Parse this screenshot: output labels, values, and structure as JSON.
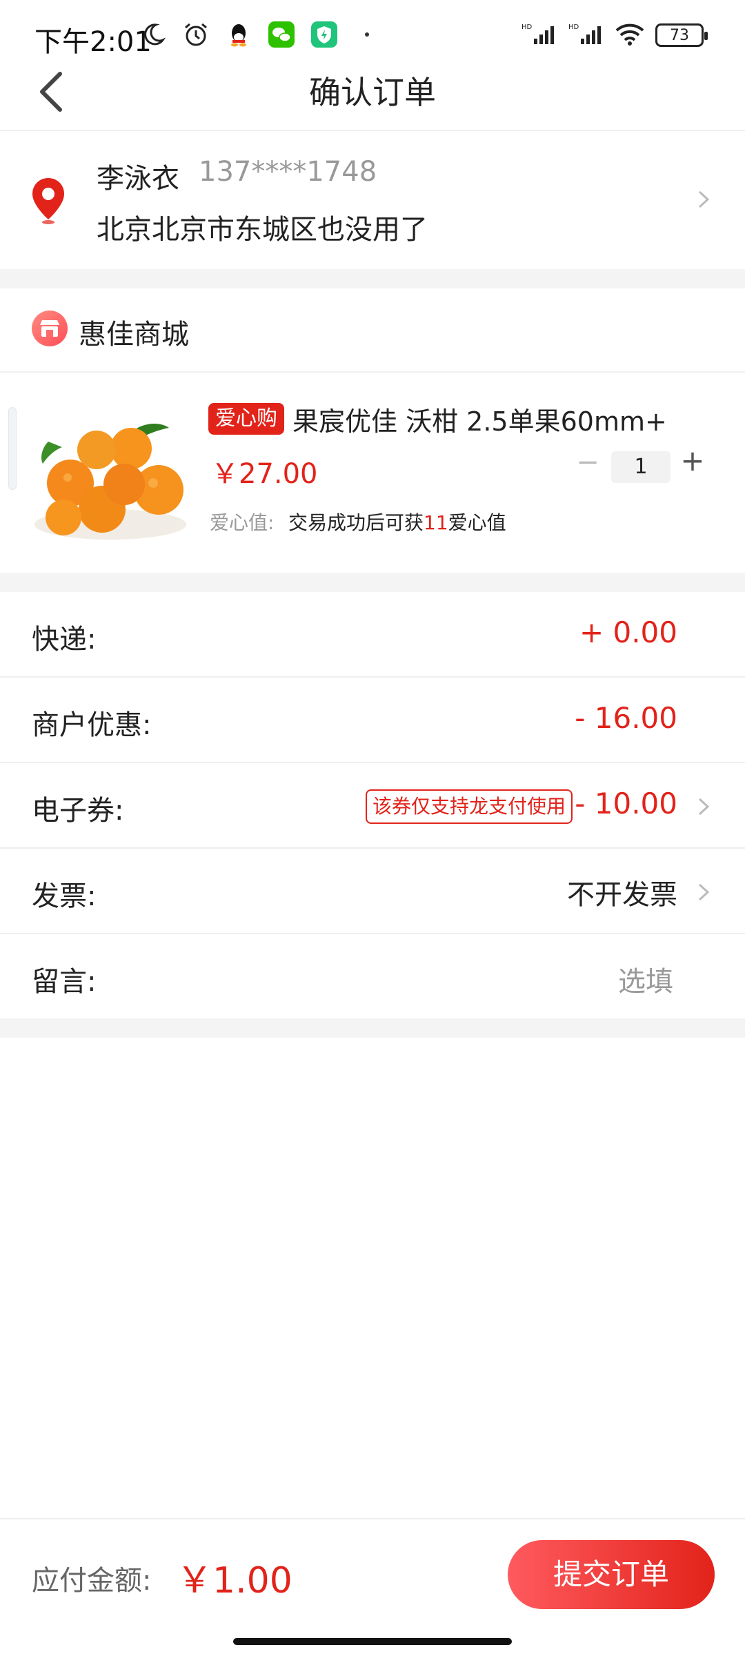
{
  "status_bar": {
    "time": "下午2:01",
    "battery": "73",
    "network_1": "HD",
    "network_2": "HD"
  },
  "header": {
    "title": "确认订单"
  },
  "address": {
    "name": "李泳衣",
    "phone": "137****1748",
    "detail": "北京北京市东城区也没用了"
  },
  "store": {
    "name": "惠佳商城"
  },
  "product": {
    "tag": "爱心购",
    "name": "果宸优佳 沃柑 2.5单果60mm+",
    "price": "￥27.00",
    "quantity": "1",
    "minus": "−",
    "plus": "+",
    "love_label": "爱心值:",
    "love_text_prefix": "交易成功后可获",
    "love_value": "11",
    "love_text_suffix": "爱心值"
  },
  "rows": {
    "shipping_label": "快递:",
    "shipping_value": "+ 0.00",
    "discount_label": "商户优惠:",
    "discount_value": "- 16.00",
    "coupon_label": "电子券:",
    "coupon_note": "该券仅支持龙支付使用",
    "coupon_value": "- 10.00",
    "invoice_label": "发票:",
    "invoice_value": "不开发票",
    "message_label": "留言:",
    "message_placeholder": "选填"
  },
  "footer": {
    "pay_label": "应付金额:",
    "pay_amount": "￥1.00",
    "submit_label": "提交订单"
  },
  "colors": {
    "accent": "#e2231a",
    "gray_bg": "#f4f4f4"
  }
}
